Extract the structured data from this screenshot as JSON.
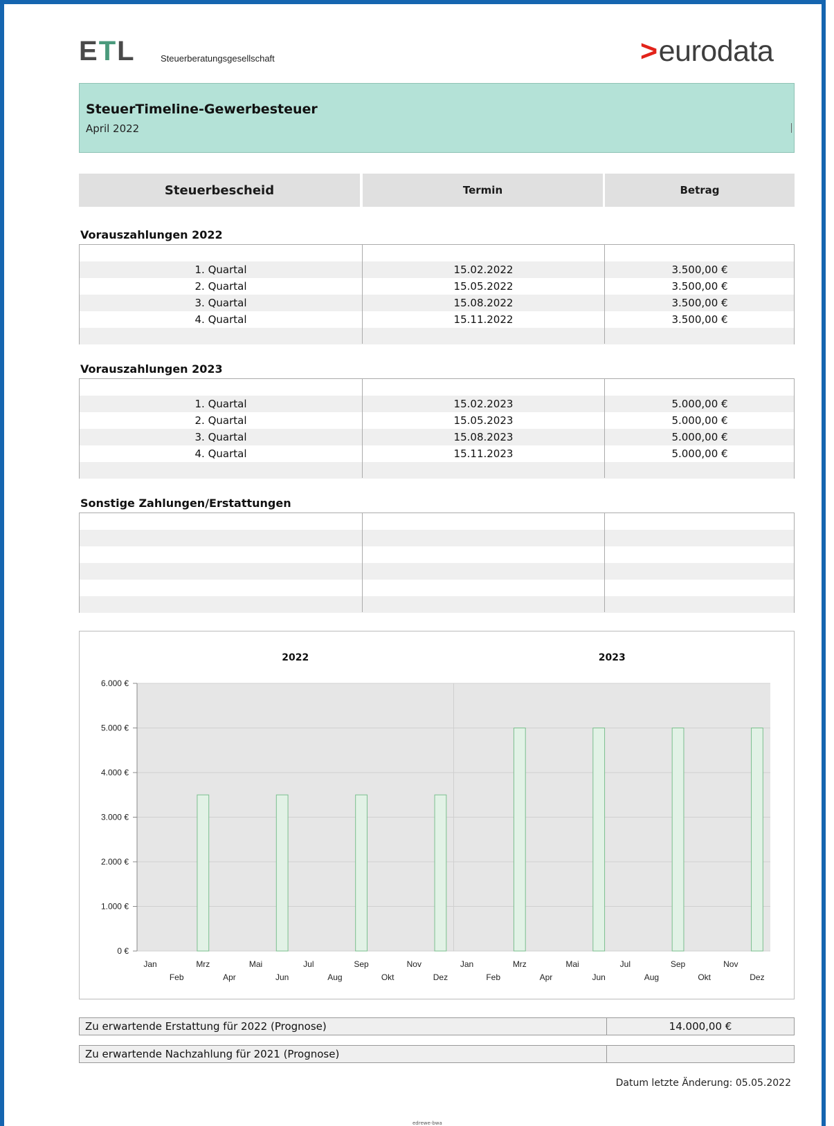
{
  "header": {
    "logo_left": "ETL",
    "logo_left_subtitle": "Steuerberatungsgesellschaft",
    "logo_right": "eurodata",
    "logo_right_mark": ">"
  },
  "title": {
    "main": "SteuerTimeline-Gewerbesteuer",
    "period": "April 2022"
  },
  "columns": {
    "c1": "Steuerbescheid",
    "c2": "Termin",
    "c3": "Betrag"
  },
  "sections": [
    {
      "title": "Vorauszahlungen 2022",
      "rows": [
        {
          "label": "1. Quartal",
          "date": "15.02.2022",
          "amount": "3.500,00 €"
        },
        {
          "label": "2. Quartal",
          "date": "15.05.2022",
          "amount": "3.500,00 €"
        },
        {
          "label": "3. Quartal",
          "date": "15.08.2022",
          "amount": "3.500,00 €"
        },
        {
          "label": "4. Quartal",
          "date": "15.11.2022",
          "amount": "3.500,00 €"
        }
      ]
    },
    {
      "title": "Vorauszahlungen 2023",
      "rows": [
        {
          "label": "1. Quartal",
          "date": "15.02.2023",
          "amount": "5.000,00 €"
        },
        {
          "label": "2. Quartal",
          "date": "15.05.2023",
          "amount": "5.000,00 €"
        },
        {
          "label": "3. Quartal",
          "date": "15.08.2023",
          "amount": "5.000,00 €"
        },
        {
          "label": "4. Quartal",
          "date": "15.11.2023",
          "amount": "5.000,00 €"
        }
      ]
    },
    {
      "title": "Sonstige Zahlungen/Erstattungen",
      "rows": []
    }
  ],
  "chart_data": {
    "type": "bar",
    "group_titles": [
      "2022",
      "2023"
    ],
    "categories": [
      "Jan",
      "Feb",
      "Mrz",
      "Apr",
      "Mai",
      "Jun",
      "Jul",
      "Aug",
      "Sep",
      "Okt",
      "Nov",
      "Dez",
      "Jan",
      "Feb",
      "Mrz",
      "Apr",
      "Mai",
      "Jun",
      "Jul",
      "Aug",
      "Sep",
      "Okt",
      "Nov",
      "Dez"
    ],
    "values": [
      0,
      0,
      3500,
      0,
      0,
      3500,
      0,
      0,
      3500,
      0,
      0,
      3500,
      0,
      0,
      5000,
      0,
      0,
      5000,
      0,
      0,
      5000,
      0,
      0,
      5000
    ],
    "ylim": [
      0,
      6000
    ],
    "yticks": [
      "0 €",
      "1.000 €",
      "2.000 €",
      "3.000 €",
      "4.000 €",
      "5.000 €",
      "6.000 €"
    ],
    "grid": true,
    "bar_color": "#e2f2e6",
    "bar_edge": "#7bbf8e",
    "plot_bg": "#e6e6e6"
  },
  "summary": [
    {
      "label": "Zu erwartende Erstattung für 2022 (Prognose)",
      "value": "14.000,00 €"
    },
    {
      "label": "Zu erwartende Nachzahlung für 2021 (Prognose)",
      "value": ""
    }
  ],
  "footer": {
    "date": "Datum letzte Änderung: 05.05.2022",
    "tiny": "edrewe-bwa"
  }
}
